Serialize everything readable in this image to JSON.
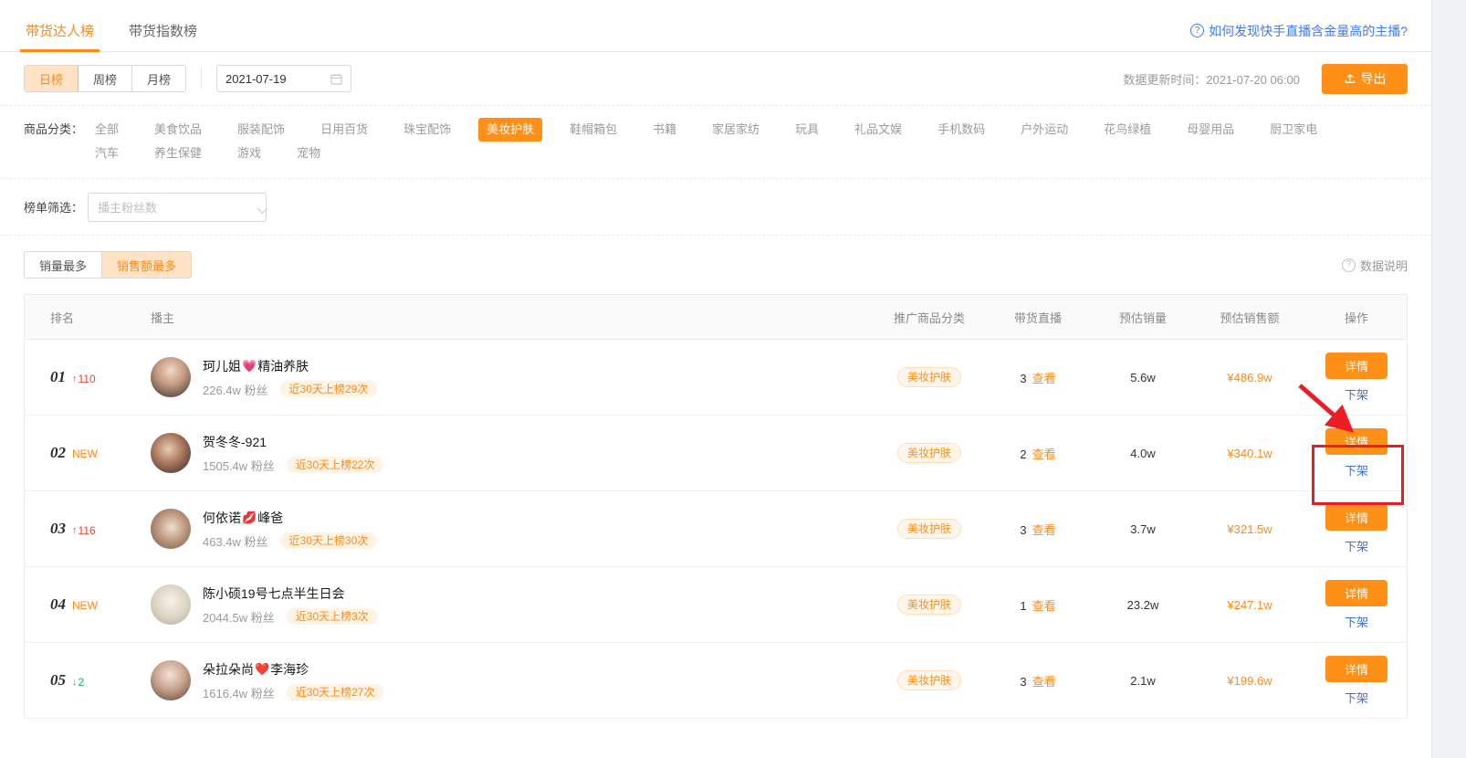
{
  "tabs": [
    {
      "label": "带货达人榜",
      "active": true
    },
    {
      "label": "带货指数榜",
      "active": false
    }
  ],
  "help_link": {
    "label": "如何发现快手直播含金量高的主播?",
    "icon": "question-circle-icon",
    "color": "#3a7bff"
  },
  "period": {
    "options": [
      {
        "label": "日榜",
        "active": true
      },
      {
        "label": "周榜",
        "active": false
      },
      {
        "label": "月榜",
        "active": false
      }
    ]
  },
  "date_picker": {
    "value": "2021-07-19",
    "icon": "calendar-icon"
  },
  "update_time": "数据更新时间：2021-07-20 06:00",
  "export_button": {
    "label": "导出",
    "icon": "upload-icon",
    "color": "#ff9017"
  },
  "category": {
    "label": "商品分类：",
    "items": [
      {
        "label": "全部",
        "active": false
      },
      {
        "label": "美食饮品",
        "active": false
      },
      {
        "label": "服装配饰",
        "active": false
      },
      {
        "label": "日用百货",
        "active": false
      },
      {
        "label": "珠宝配饰",
        "active": false
      },
      {
        "label": "美妆护肤",
        "active": true
      },
      {
        "label": "鞋帽箱包",
        "active": false
      },
      {
        "label": "书籍",
        "active": false
      },
      {
        "label": "家居家纺",
        "active": false
      },
      {
        "label": "玩具",
        "active": false
      },
      {
        "label": "礼品文娱",
        "active": false
      },
      {
        "label": "手机数码",
        "active": false
      },
      {
        "label": "户外运动",
        "active": false
      },
      {
        "label": "花鸟绿植",
        "active": false
      },
      {
        "label": "母婴用品",
        "active": false
      },
      {
        "label": "厨卫家电",
        "active": false
      },
      {
        "label": "汽车",
        "active": false
      },
      {
        "label": "养生保健",
        "active": false
      },
      {
        "label": "游戏",
        "active": false
      },
      {
        "label": "宠物",
        "active": false
      }
    ]
  },
  "rank_filter": {
    "label": "榜单筛选：",
    "select_placeholder": "播主粉丝数",
    "select_value": "播主粉丝数",
    "icon": "chevron-down-icon"
  },
  "sort": {
    "options": [
      {
        "label": "销量最多",
        "active": false
      },
      {
        "label": "销售额最多",
        "active": true
      }
    ],
    "data_note": {
      "label": "数据说明",
      "icon": "question-circle-icon"
    }
  },
  "table": {
    "headers": {
      "rank": "排名",
      "host": "播主",
      "promo_category": "推广商品分类",
      "live": "带货直播",
      "sales": "预估销量",
      "amount": "预估销售额",
      "operation": "操作"
    },
    "row_actions": {
      "detail": "详情",
      "unlist": "下架",
      "view": "查看"
    },
    "rows": [
      {
        "rank": "01",
        "delta": "110",
        "delta_dir": "up",
        "name_prefix": "珂儿姐",
        "emoji": "💗",
        "name_suffix": "精油养肤",
        "fans": "226.4w 粉丝",
        "badge": "近30天上榜29次",
        "promo_category": "美妆护肤",
        "live_count": "3",
        "sales": "5.6w",
        "amount": "¥486.9w",
        "avatar_colors": [
          "#3a2f2c",
          "#cdb6a4"
        ]
      },
      {
        "rank": "02",
        "delta": "NEW",
        "delta_dir": "new",
        "name_prefix": "贺冬冬-921",
        "emoji": "",
        "name_suffix": "",
        "fans": "1505.4w 粉丝",
        "badge": "近30天上榜22次",
        "promo_category": "美妆护肤",
        "live_count": "2",
        "sales": "4.0w",
        "amount": "¥340.1w",
        "avatar_colors": [
          "#4a332c",
          "#b98f78"
        ]
      },
      {
        "rank": "03",
        "delta": "116",
        "delta_dir": "up",
        "name_prefix": "何依诺",
        "emoji": "💋",
        "name_suffix": "峰爸",
        "fans": "463.4w 粉丝",
        "badge": "近30天上榜30次",
        "promo_category": "美妆护肤",
        "live_count": "3",
        "sales": "3.7w",
        "amount": "¥321.5w",
        "avatar_colors": [
          "#c9b5a6",
          "#8a6a55"
        ]
      },
      {
        "rank": "04",
        "delta": "NEW",
        "delta_dir": "new",
        "name_prefix": "陈小硕19号七点半生日会",
        "emoji": "",
        "name_suffix": "",
        "fans": "2044.5w 粉丝",
        "badge": "近30天上榜3次",
        "promo_category": "美妆护肤",
        "live_count": "1",
        "sales": "23.2w",
        "amount": "¥247.1w",
        "avatar_colors": [
          "#e3ded4",
          "#b4a894"
        ]
      },
      {
        "rank": "05",
        "delta": "2",
        "delta_dir": "down",
        "name_prefix": "朵拉朵尚",
        "emoji": "❤️",
        "name_suffix": "李海珍",
        "fans": "1616.4w 粉丝",
        "badge": "近30天上榜27次",
        "promo_category": "美妆护肤",
        "live_count": "3",
        "sales": "2.1w",
        "amount": "¥199.6w",
        "avatar_colors": [
          "#d8c8bd",
          "#6b4c3e"
        ]
      }
    ]
  },
  "annotations": {
    "highlight_box_color": "#ec1c24",
    "arrow_color": "#ec1c24"
  }
}
